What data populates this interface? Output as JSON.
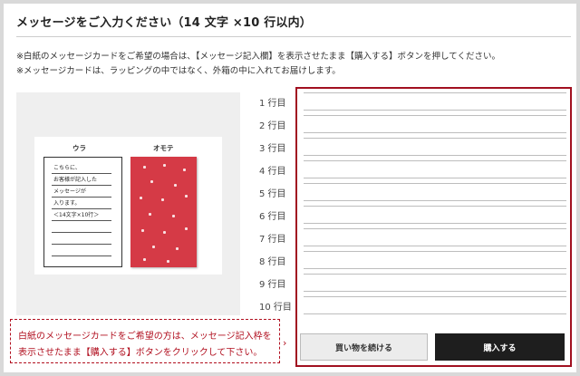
{
  "heading": "メッセージをご入力ください（14 文字 ×10 行以内）",
  "notes": [
    "※白紙のメッセージカードをご希望の場合は、【メッセージ記入欄】を表示させたまま【購入する】ボタンを押してください。",
    "※メッセージカードは、ラッピングの中ではなく、外箱の中に入れてお届けします。"
  ],
  "sample": {
    "back_label": "ウラ",
    "front_label": "オモテ",
    "back_lines": [
      "こちらに、",
      "お客様が記入した",
      "メッセージが",
      "入ります。",
      "＜14文字×10行＞"
    ]
  },
  "hint": {
    "line1": "白紙のメッセージカードをご希望の方は、メッセージ記入枠を",
    "line2": "表示させたまま【購入する】ボタンをクリックして下さい。",
    "chevron": "›"
  },
  "message_lines": [
    {
      "label": "1 行目",
      "value": ""
    },
    {
      "label": "2 行目",
      "value": ""
    },
    {
      "label": "3 行目",
      "value": ""
    },
    {
      "label": "4 行目",
      "value": ""
    },
    {
      "label": "5 行目",
      "value": ""
    },
    {
      "label": "6 行目",
      "value": ""
    },
    {
      "label": "7 行目",
      "value": ""
    },
    {
      "label": "8 行目",
      "value": ""
    },
    {
      "label": "9 行目",
      "value": ""
    },
    {
      "label": "10 行目",
      "value": ""
    }
  ],
  "buttons": {
    "continue_shopping": "買い物を続ける",
    "buy": "購入する"
  },
  "colors": {
    "accent_red": "#a11020",
    "card_red": "#d53a46",
    "buy_button": "#1e1e1e"
  }
}
